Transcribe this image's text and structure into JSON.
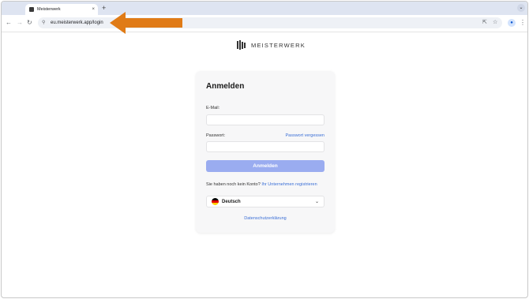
{
  "browser": {
    "tab_title": "Meisterwerk",
    "tab_close": "×",
    "new_tab": "+",
    "tab_menu": "⌄",
    "url": "eu.meisterwerk.app/login",
    "back": "←",
    "forward": "→",
    "reload": "↻",
    "site_info": "⚲",
    "install": "⇱",
    "bookmark": "☆",
    "profile": "●",
    "menu": "⋮"
  },
  "annotation": {
    "arrow_color": "#e07b16"
  },
  "logo": {
    "text": "MEISTERWERK"
  },
  "login": {
    "title": "Anmelden",
    "email_label": "E-Mail:",
    "email_value": "",
    "password_label": "Passwort:",
    "password_value": "",
    "forgot_password": "Passwort vergessen",
    "submit_label": "Anmelden",
    "no_account_text": "Sie haben noch kein Konto? ",
    "register_link": "Ihr Unternehmen registrieren",
    "language": "Deutsch",
    "language_chevron": "⌄",
    "privacy_link": "Datenschutzerklärung"
  },
  "colors": {
    "accent": "#3b6fd6",
    "button_disabled": "#9aacf0",
    "tabstrip": "#dee4f1"
  }
}
